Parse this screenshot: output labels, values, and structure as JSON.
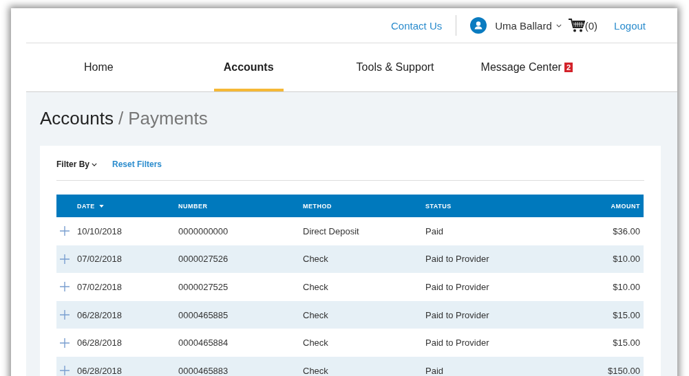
{
  "header": {
    "contact_link": "Contact Us",
    "user_name": "Uma Ballard",
    "cart_count": "(0)",
    "logout_link": "Logout"
  },
  "nav_tabs": [
    {
      "label": "Home",
      "selected": false
    },
    {
      "label": "Accounts",
      "selected": true
    },
    {
      "label": "Tools & Support",
      "selected": false
    },
    {
      "label": "Message Center",
      "selected": false,
      "badge": "2"
    }
  ],
  "page_title": {
    "section": "Accounts",
    "separator": "/",
    "page": "Payments"
  },
  "filters": {
    "filter_label": "Filter By",
    "reset_link": "Reset Filters"
  },
  "table": {
    "columns": [
      {
        "label": "DATE",
        "sorted": true
      },
      {
        "label": "NUMBER",
        "sorted": false
      },
      {
        "label": "METHOD",
        "sorted": false
      },
      {
        "label": "STATUS",
        "sorted": false
      },
      {
        "label": "AMOUNT",
        "sorted": false
      }
    ],
    "rows": [
      {
        "date": "10/10/2018",
        "number": "0000000000",
        "method": "Direct Deposit",
        "status": "Paid",
        "amount": "$36.00"
      },
      {
        "date": "07/02/2018",
        "number": "0000027526",
        "method": "Check",
        "status": "Paid to Provider",
        "amount": "$10.00"
      },
      {
        "date": "07/02/2018",
        "number": "0000027525",
        "method": "Check",
        "status": "Paid to Provider",
        "amount": "$10.00"
      },
      {
        "date": "06/28/2018",
        "number": "0000465885",
        "method": "Check",
        "status": "Paid to Provider",
        "amount": "$15.00"
      },
      {
        "date": "06/28/2018",
        "number": "0000465884",
        "method": "Check",
        "status": "Paid to Provider",
        "amount": "$15.00"
      },
      {
        "date": "06/28/2018",
        "number": "0000465883",
        "method": "Check",
        "status": "Paid",
        "amount": "$150.00"
      }
    ]
  }
}
